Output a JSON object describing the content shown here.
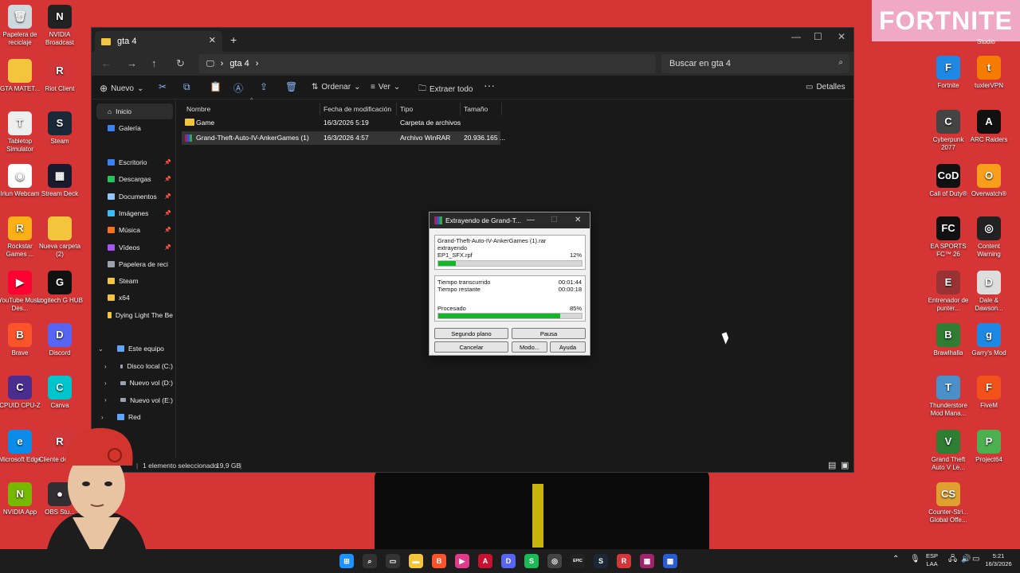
{
  "desktop": {
    "left_icons": [
      {
        "name": "recycle-bin-icon",
        "label": "Papelera de reciclaje",
        "bg": "#cfd8dc",
        "glyph": "🗑"
      },
      {
        "name": "nvidia-broadcast-icon",
        "label": "NVIDIA Broadcast",
        "bg": "#222",
        "glyph": "N"
      },
      {
        "name": "gta-folder-icon",
        "label": "GTA MATET...",
        "bg": "#f2c53d",
        "glyph": ""
      },
      {
        "name": "riot-client-icon",
        "label": "Riot Client",
        "bg": "#d13639",
        "glyph": "R"
      },
      {
        "name": "tabletop-simulator-icon",
        "label": "Tabletop Simulator",
        "bg": "#eee",
        "glyph": "T"
      },
      {
        "name": "steam-icon",
        "label": "Steam",
        "bg": "#1b2838",
        "glyph": "S"
      },
      {
        "name": "iriun-webcam-icon",
        "label": "Iriun Webcam",
        "bg": "#fff",
        "glyph": "◉"
      },
      {
        "name": "stream-deck-icon",
        "label": "Stream Deck",
        "bg": "#1a1a2e",
        "glyph": "▦"
      },
      {
        "name": "rockstar-games-icon",
        "label": "Rockstar Games ...",
        "bg": "#fcaf17",
        "glyph": "R"
      },
      {
        "name": "nueva-carpeta-icon",
        "label": "Nueva carpeta (2)",
        "bg": "#f2c53d",
        "glyph": ""
      },
      {
        "name": "youtube-music-icon",
        "label": "YouTube Music Des...",
        "bg": "#ff0033",
        "glyph": "▶"
      },
      {
        "name": "logitech-hub-icon",
        "label": "Logitech G HUB",
        "bg": "#111",
        "glyph": "G"
      },
      {
        "name": "brave-icon",
        "label": "Brave",
        "bg": "#fb542b",
        "glyph": "B"
      },
      {
        "name": "discord-icon",
        "label": "Discord",
        "bg": "#5865f2",
        "glyph": "D"
      },
      {
        "name": "cpuid-icon",
        "label": "CPUID CPU-Z",
        "bg": "#4b2d8f",
        "glyph": "C"
      },
      {
        "name": "canva-icon",
        "label": "Canva",
        "bg": "#00c4cc",
        "glyph": "C"
      },
      {
        "name": "edge-icon",
        "label": "Microsoft Edge",
        "bg": "#0c8ce9",
        "glyph": "e"
      },
      {
        "name": "riot-client-2-icon",
        "label": "Cliente de Riot",
        "bg": "#d13639",
        "glyph": "R"
      },
      {
        "name": "nvidia-app-icon",
        "label": "NVIDIA App",
        "bg": "#76b900",
        "glyph": "N"
      },
      {
        "name": "obs-icon",
        "label": "OBS Stu...",
        "bg": "#302e31",
        "glyph": "●"
      }
    ],
    "right_icons": [
      {
        "name": "fortnite-icon",
        "label": "Fortnite",
        "bg": "#1e88e5",
        "glyph": "F"
      },
      {
        "name": "tuxler-icon",
        "label": "tuxlerVPN",
        "bg": "#f57c00",
        "glyph": "t"
      },
      {
        "name": "cyberpunk-icon",
        "label": "Cyberpunk 2077",
        "bg": "#444",
        "glyph": "C"
      },
      {
        "name": "arc-raiders-icon",
        "label": "ARC Raiders",
        "bg": "#111",
        "glyph": "A"
      },
      {
        "name": "call-of-duty-icon",
        "label": "Call of Duty®",
        "bg": "#111",
        "glyph": "CoD"
      },
      {
        "name": "overwatch-icon",
        "label": "Overwatch®",
        "bg": "#f99e1a",
        "glyph": "O"
      },
      {
        "name": "ea-fc-icon",
        "label": "EA SPORTS FC™ 26",
        "bg": "#111",
        "glyph": "FC"
      },
      {
        "name": "content-warning-icon",
        "label": "Content Warning",
        "bg": "#222",
        "glyph": "◎"
      },
      {
        "name": "entrenador-icon",
        "label": "Entrenador de punter...",
        "bg": "#933",
        "glyph": "E"
      },
      {
        "name": "dale-dawson-icon",
        "label": "Dale & Dawson...",
        "bg": "#ddd",
        "glyph": "D"
      },
      {
        "name": "brawlhalla-icon",
        "label": "Brawlhalla",
        "bg": "#2e7d32",
        "glyph": "B"
      },
      {
        "name": "garrys-mod-icon",
        "label": "Garry's Mod",
        "bg": "#1e88e5",
        "glyph": "g"
      },
      {
        "name": "thunderstore-icon",
        "label": "Thunderstore Mod Mana...",
        "bg": "#4a90c8",
        "glyph": "T"
      },
      {
        "name": "fivem-icon",
        "label": "FiveM",
        "bg": "#f2511b",
        "glyph": "F"
      },
      {
        "name": "gta-v-icon",
        "label": "Grand Theft Auto V Le...",
        "bg": "#2e7d32",
        "glyph": "V"
      },
      {
        "name": "project64-icon",
        "label": "Project64",
        "bg": "#4caf50",
        "glyph": "P"
      },
      {
        "name": "counter-strike-icon",
        "label": "Counter-Stri... Global Offe...",
        "bg": "#e0a030",
        "glyph": "CS"
      }
    ],
    "fortnite_banner": "FORTNITE",
    "studio_label": "Studio"
  },
  "explorer": {
    "tab_title": "gta 4",
    "breadcrumb": "gta 4",
    "search_placeholder": "Buscar en gta 4",
    "toolbar": {
      "new": "Nuevo",
      "sort": "Ordenar",
      "view": "Ver",
      "extract": "Extraer todo",
      "details": "Detalles"
    },
    "sidebar": {
      "home": "Inicio",
      "gallery": "Galería",
      "quick": [
        {
          "label": "Escritorio",
          "color": "#3b82f6"
        },
        {
          "label": "Descargas",
          "color": "#22c55e"
        },
        {
          "label": "Documentos",
          "color": "#93c5fd"
        },
        {
          "label": "Imágenes",
          "color": "#38bdf8"
        },
        {
          "label": "Música",
          "color": "#f97316"
        },
        {
          "label": "Vídeos",
          "color": "#a855f7"
        },
        {
          "label": "Papelera de reci",
          "color": "#9ca3af"
        },
        {
          "label": "Steam",
          "color": "#f2c53d"
        },
        {
          "label": "x64",
          "color": "#f2c53d"
        },
        {
          "label": "Dying Light The Be",
          "color": "#f2c53d"
        }
      ],
      "this_pc": "Este equipo",
      "drives": [
        "Disco local (C:)",
        "Nuevo vol (D:)",
        "Nuevo vol (E:)"
      ],
      "network": "Red"
    },
    "columns": {
      "name": "Nombre",
      "modified": "Fecha de modificación",
      "type": "Tipo",
      "size": "Tamaño"
    },
    "files": [
      {
        "name": "Game",
        "modified": "16/3/2026 5:19",
        "type": "Carpeta de archivos",
        "size": ""
      },
      {
        "name": "Grand-Theft-Auto-IV-AnkerGames (1)",
        "modified": "16/3/2026 4:57",
        "type": "Archivo WinRAR",
        "size": "20.936.165 ..."
      }
    ],
    "status": {
      "items": "1 elemento seleccionado",
      "size": "19,9 GB"
    }
  },
  "dialog": {
    "title": "Extrayendo de Grand-T...",
    "archive": "Grand-Theft-Auto-IV-AnkerGames (1).rar",
    "action": "extrayendo",
    "file": "EP1_SFX.rpf",
    "file_pct": "12%",
    "file_progress": 0.12,
    "elapsed_label": "Tiempo transcurrido",
    "elapsed": "00:01:44",
    "remaining_label": "Tiempo restante",
    "remaining": "00:00:18",
    "processed_label": "Procesado",
    "processed_pct": "85%",
    "processed_progress": 0.85,
    "buttons": {
      "background": "Segundo plano",
      "pause": "Pausa",
      "cancel": "Cancelar",
      "mode": "Modo...",
      "help": "Ayuda"
    }
  },
  "taskbar": {
    "lang": "ESP",
    "lang2": "LAA",
    "time": "5:21",
    "date": "16/3/2026"
  }
}
